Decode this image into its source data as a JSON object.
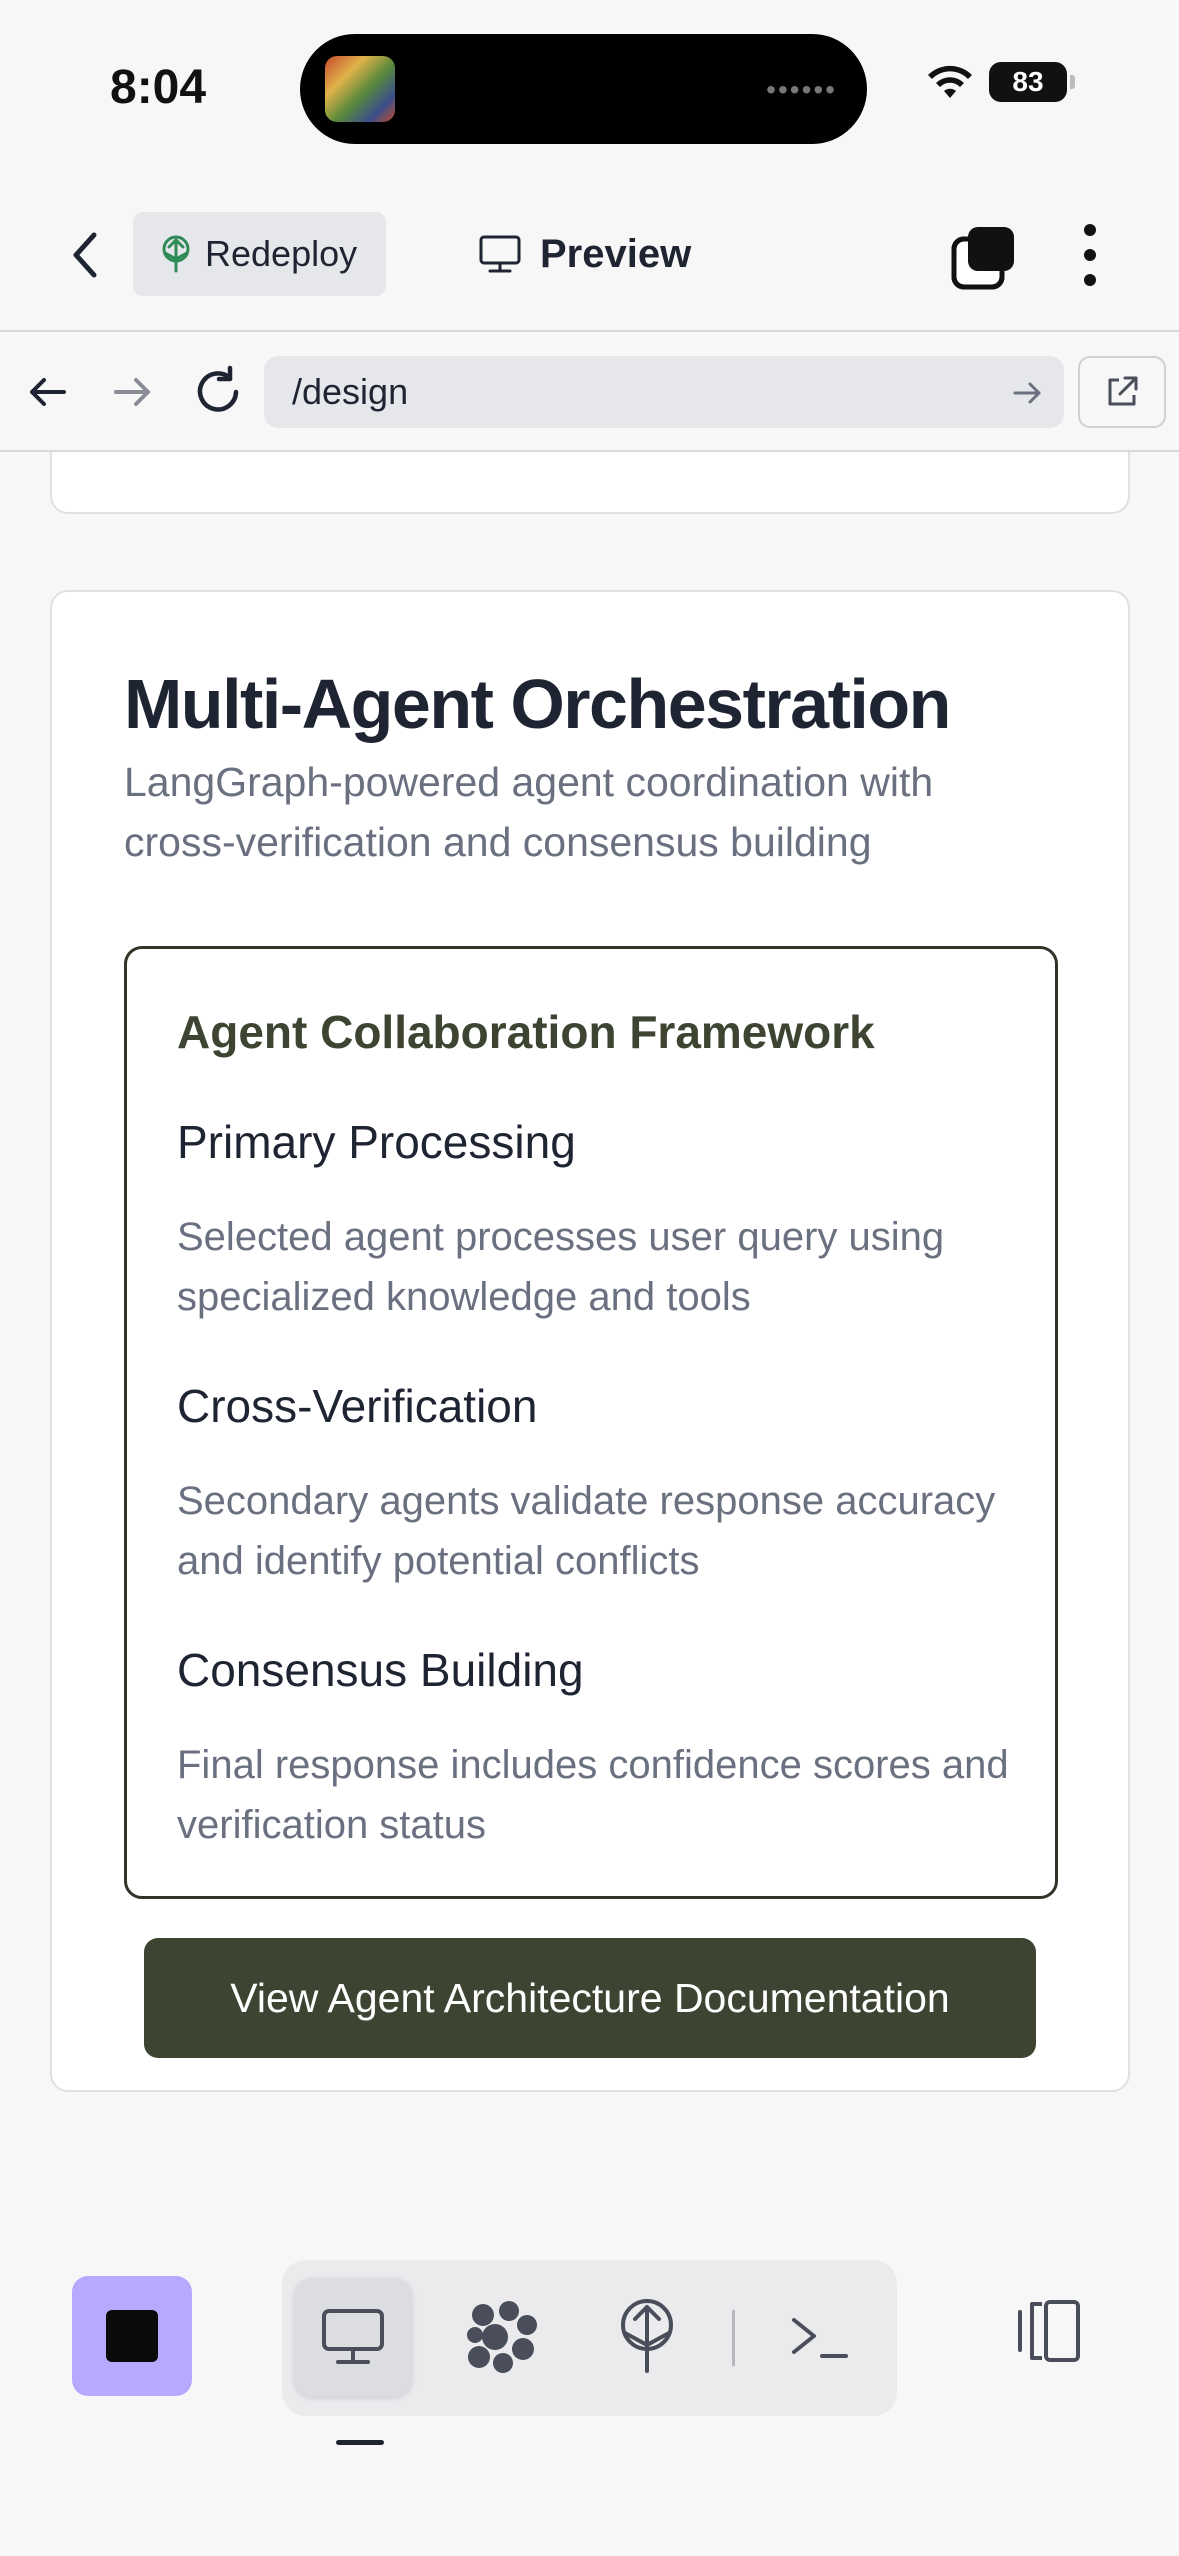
{
  "status_bar": {
    "time": "8:04",
    "battery": "83",
    "icons": [
      "wifi-icon",
      "battery-icon"
    ]
  },
  "toolbar": {
    "redeploy_label": "Redeploy",
    "preview_label": "Preview",
    "icons": [
      "chevron-left-icon",
      "deploy-tree-icon",
      "monitor-icon",
      "tabs-stack-icon",
      "more-vertical-icon"
    ]
  },
  "browser": {
    "url": "/design",
    "icons": [
      "arrow-left-icon",
      "arrow-right-icon",
      "reload-icon",
      "go-arrow-icon",
      "open-external-icon"
    ]
  },
  "card": {
    "title": "Multi-Agent Orchestration",
    "subtitle": "LangGraph-powered agent coordination with cross-verification and consensus building",
    "framework": {
      "title": "Agent Collaboration Framework",
      "steps": [
        {
          "title": "Primary Processing",
          "desc": "Selected agent processes user query using specialized knowledge and tools"
        },
        {
          "title": "Cross-Verification",
          "desc": "Secondary agents validate response accuracy and identify potential conflicts"
        },
        {
          "title": "Consensus Building",
          "desc": "Final response includes confidence scores and verification status"
        }
      ]
    },
    "button_label": "View Agent Architecture Documentation"
  },
  "bottom_bar": {
    "active_mode": "preview",
    "icons": [
      "stop-icon",
      "monitor-icon",
      "agents-icon",
      "deploy-tree-icon",
      "terminal-icon",
      "side-panel-icon"
    ]
  },
  "colors": {
    "accent_olive": "#3d4532",
    "stop_purple": "#b9a8ff",
    "background": "#f7f7f8"
  }
}
